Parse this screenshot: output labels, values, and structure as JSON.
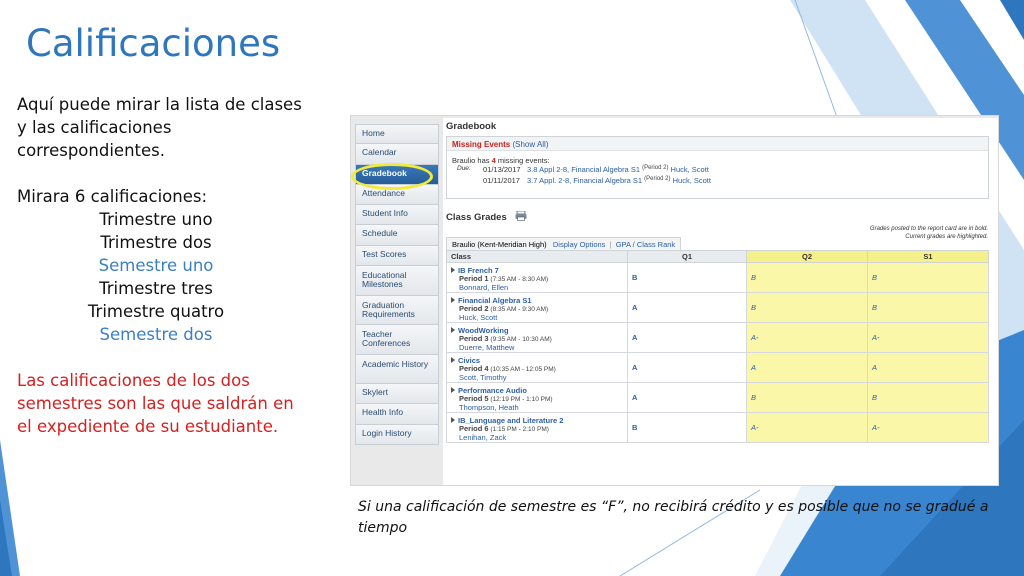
{
  "slide": {
    "title": "Calificaciones",
    "intro": "Aquí puede mirar la lista de clases y las calificaciones correspondientes.",
    "count_line": "Mirara 6 calificaciones:",
    "periods": [
      {
        "label": "Trimestre uno",
        "color": "#111111"
      },
      {
        "label": "Trimestre dos",
        "color": "#111111"
      },
      {
        "label": "Semestre uno",
        "color": "#3a7fc4"
      },
      {
        "label": "Trimestre tres",
        "color": "#111111"
      },
      {
        "label": "Trimestre quatro",
        "color": "#111111"
      },
      {
        "label": "Semestre dos",
        "color": "#3a7fc4"
      }
    ],
    "warning": "Las calificaciones de los dos semestres son las que saldrán en el expediente de su estudiante.",
    "caption": "Si una calificación de semestre es “F”, no recibirá crédito y es posible que no se gradué a tiempo",
    "colors": {
      "title": "#2e76bd",
      "accent_blue": "#3a7fc4",
      "warning_red": "#d42020",
      "highlight_circle": "#f0ea3c"
    }
  },
  "screenshot": {
    "nav": [
      {
        "label": "Home"
      },
      {
        "label": "Calendar"
      },
      {
        "label": "Gradebook",
        "active": true
      },
      {
        "label": "Attendance"
      },
      {
        "label": "Student Info"
      },
      {
        "label": "Schedule"
      },
      {
        "label": "Test Scores"
      },
      {
        "label": "Educational Milestones"
      },
      {
        "label": "Graduation Requirements"
      },
      {
        "label": "Teacher Conferences"
      },
      {
        "label": "Academic History"
      },
      {
        "label": "Skylert"
      },
      {
        "label": "Health Info"
      },
      {
        "label": "Login History"
      }
    ],
    "gradebook_title": "Gradebook",
    "missing_events": {
      "heading": "Missing Events",
      "show_all": "(Show All)",
      "summary_prefix": "Braulio has",
      "count": "4",
      "summary_suffix": "missing events:",
      "due_label": "Due:",
      "items": [
        {
          "date": "01/13/2017",
          "assignment": "3.8 Appl 2-8, Financial Algebra S1",
          "period": "(Period 2)",
          "teacher": "Huck, Scott"
        },
        {
          "date": "01/11/2017",
          "assignment": "3.7 Appl. 2-8, Financial Algebra S1",
          "period": "(Period 2)",
          "teacher": "Huck, Scott"
        }
      ]
    },
    "class_grades_title": "Class Grades",
    "note_line1": "Grades posted to the report card are in bold.",
    "note_line2": "Current grades are highlighted.",
    "tabs": {
      "student": "Braulio (Kent-Meridian High)",
      "display_options": "Display Options",
      "sep": "|",
      "gpa": "GPA / Class Rank"
    },
    "columns": [
      "Class",
      "Q1",
      "Q2",
      "S1"
    ],
    "classes": [
      {
        "name": "IB French 7",
        "period_label": "Period 1",
        "time": "(7:35 AM - 8:30 AM)",
        "teacher": "Bonnard, Ellen",
        "q1": "B",
        "q2": "B",
        "s1": "B"
      },
      {
        "name": "Financial Algebra S1",
        "period_label": "Period 2",
        "time": "(8:35 AM - 9:30 AM)",
        "teacher": "Huck, Scott",
        "q1": "A",
        "q2": "B",
        "s1": "B"
      },
      {
        "name": "WoodWorking",
        "period_label": "Period 3",
        "time": "(9:35 AM - 10:30 AM)",
        "teacher": "Duerre, Matthew",
        "q1": "A",
        "q2": "A-",
        "s1": "A-"
      },
      {
        "name": "Civics",
        "period_label": "Period 4",
        "time": "(10:35 AM - 12:05 PM)",
        "teacher": "Scott, Timothy",
        "q1": "A",
        "q2": "A",
        "s1": "A"
      },
      {
        "name": "Performance Audio",
        "period_label": "Period 5",
        "time": "(12:19 PM - 1:10 PM)",
        "teacher": "Thompson, Heath",
        "q1": "A",
        "q2": "B",
        "s1": "B"
      },
      {
        "name": "IB_Language and Literature 2",
        "period_label": "Period 6",
        "time": "(1:15 PM - 2:10 PM)",
        "teacher": "Lenihan, Zack",
        "q1": "B",
        "q2": "A-",
        "s1": "A-"
      }
    ]
  }
}
